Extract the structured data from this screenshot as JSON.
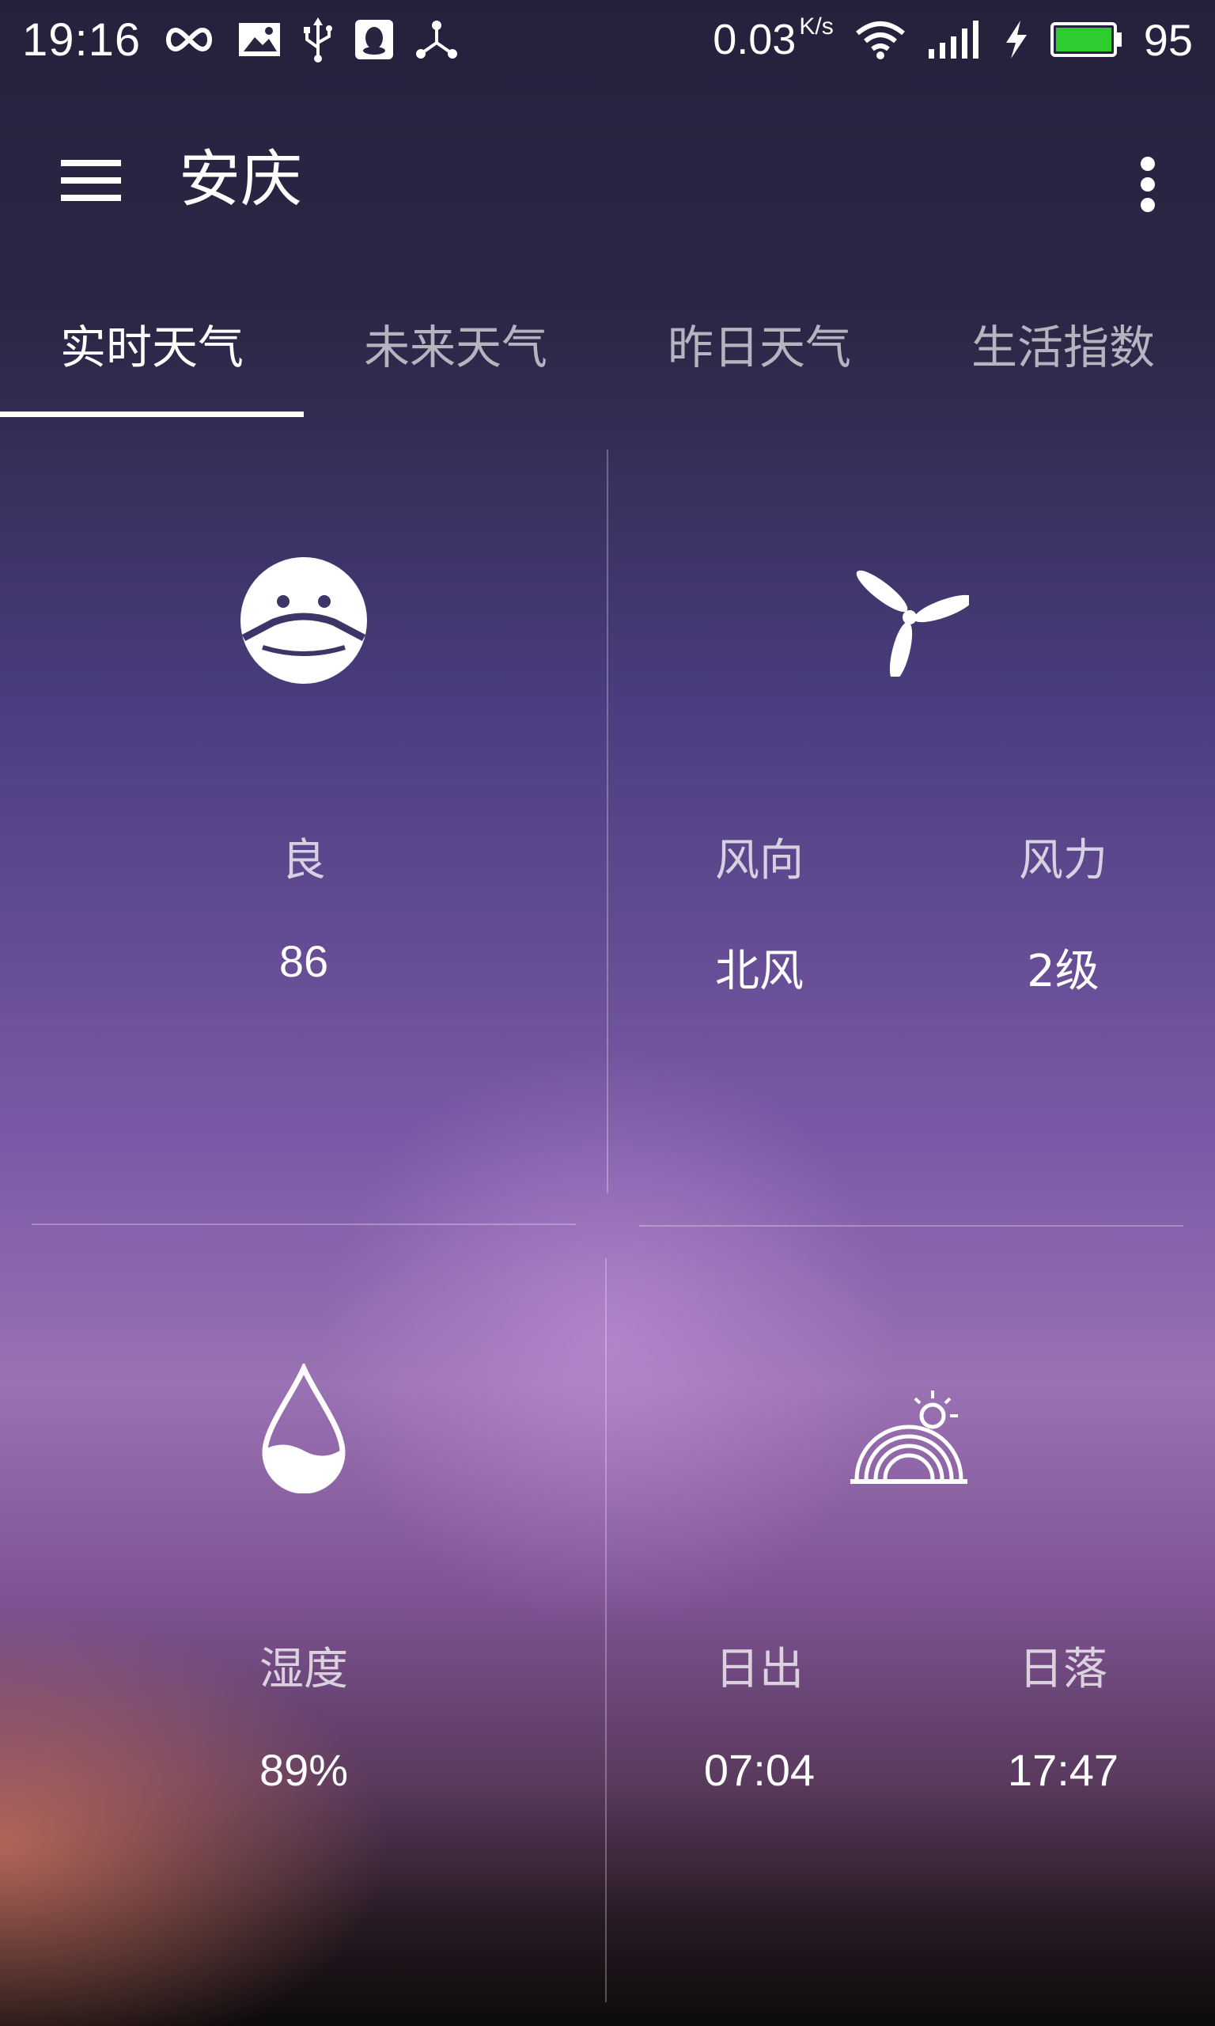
{
  "status_bar": {
    "time": "19:16",
    "net_speed": "0.03",
    "net_speed_unit": "K/s",
    "battery": "95",
    "icons": [
      "infinity-icon",
      "image-icon",
      "usb-icon",
      "qq-icon",
      "share-icon",
      "wifi-icon",
      "signal-icon",
      "charging-icon",
      "battery-icon"
    ]
  },
  "app_bar": {
    "city": "安庆",
    "menu_icon": "hamburger-menu-icon",
    "more_icon": "more-vert-icon"
  },
  "tabs": [
    {
      "label": "实时天气",
      "active": true
    },
    {
      "label": "未来天气",
      "active": false
    },
    {
      "label": "昨日天气",
      "active": false
    },
    {
      "label": "生活指数",
      "active": false
    }
  ],
  "air_quality": {
    "icon": "mask-face-icon",
    "label": "良",
    "value": "86"
  },
  "wind": {
    "icon": "fan-icon",
    "direction_label": "风向",
    "direction_value": "北风",
    "force_label": "风力",
    "force_value": "2级"
  },
  "humidity": {
    "icon": "water-drop-icon",
    "label": "湿度",
    "value": "89%"
  },
  "sun": {
    "icon": "sunrise-icon",
    "sunrise_label": "日出",
    "sunrise_value": "07:04",
    "sunset_label": "日落",
    "sunset_value": "17:47"
  },
  "colors": {
    "text": "#ffffff",
    "battery_fill": "#2ecc2e",
    "bg_top": "#25213c",
    "bg_mid": "#7b5aa7",
    "bg_bottom": "#0c0a0c"
  }
}
